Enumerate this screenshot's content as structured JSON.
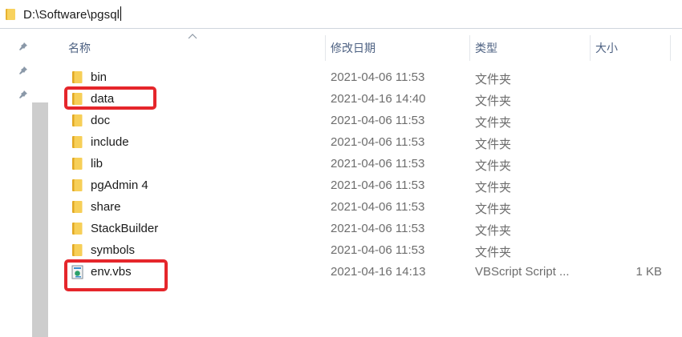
{
  "address_bar": {
    "path": "D:\\Software\\pgsql"
  },
  "columns": {
    "name": "名称",
    "date_modified": "修改日期",
    "type": "类型",
    "size": "大小"
  },
  "files": [
    {
      "name": "bin",
      "date": "2021-04-06 11:53",
      "type": "文件夹",
      "size": "",
      "icon": "folder-icon",
      "highlighted": false
    },
    {
      "name": "data",
      "date": "2021-04-16 14:40",
      "type": "文件夹",
      "size": "",
      "icon": "folder-icon",
      "highlighted": true
    },
    {
      "name": "doc",
      "date": "2021-04-06 11:53",
      "type": "文件夹",
      "size": "",
      "icon": "folder-icon",
      "highlighted": false
    },
    {
      "name": "include",
      "date": "2021-04-06 11:53",
      "type": "文件夹",
      "size": "",
      "icon": "folder-icon",
      "highlighted": false
    },
    {
      "name": "lib",
      "date": "2021-04-06 11:53",
      "type": "文件夹",
      "size": "",
      "icon": "folder-icon",
      "highlighted": false
    },
    {
      "name": "pgAdmin 4",
      "date": "2021-04-06 11:53",
      "type": "文件夹",
      "size": "",
      "icon": "folder-icon",
      "highlighted": false
    },
    {
      "name": "share",
      "date": "2021-04-06 11:53",
      "type": "文件夹",
      "size": "",
      "icon": "folder-icon",
      "highlighted": false
    },
    {
      "name": "StackBuilder",
      "date": "2021-04-06 11:53",
      "type": "文件夹",
      "size": "",
      "icon": "folder-icon",
      "highlighted": false
    },
    {
      "name": "symbols",
      "date": "2021-04-06 11:53",
      "type": "文件夹",
      "size": "",
      "icon": "folder-icon",
      "highlighted": false
    },
    {
      "name": "env.vbs",
      "date": "2021-04-16 14:13",
      "type": "VBScript Script ...",
      "size": "1 KB",
      "icon": "vbscript-file-icon",
      "highlighted": true
    }
  ],
  "colors": {
    "highlight": "#e5262b",
    "folder": "#f3c34d",
    "header_text": "#4d6182"
  }
}
